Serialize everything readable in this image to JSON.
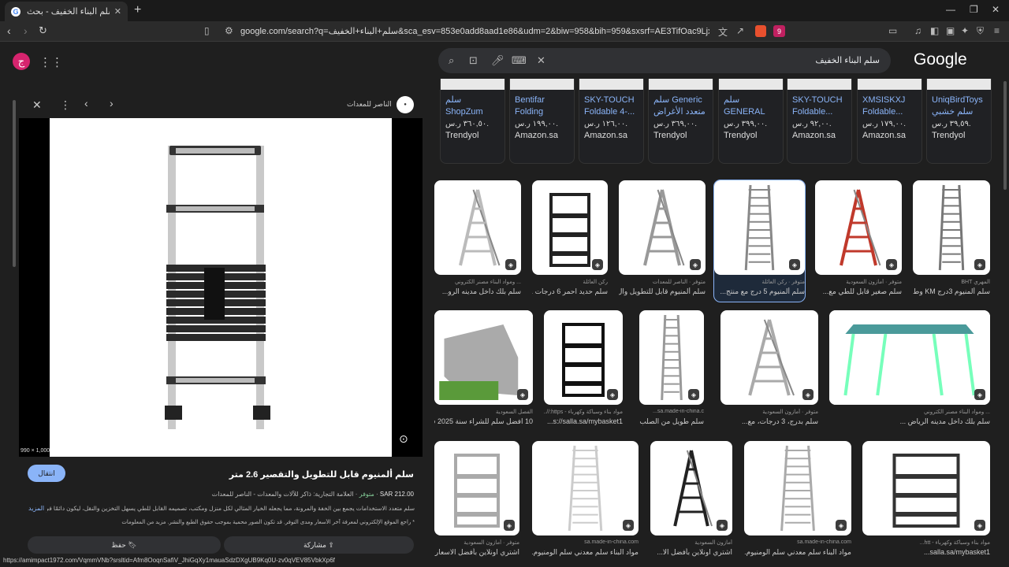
{
  "browser": {
    "tab_title": "سلم البناء الخفيف - بحث Google",
    "url": "google.com/search?q=سلم+البناء+الخفيف&sca_esv=853e0add8aad1e86&udm=2&biw=958&bih=959&sxsrf=AE3TifOac9Ljxx6mElPceLPNe4Me...",
    "status_url": "https://amimpact1972.com/VqmmVNb?srsltid=Afm8OoqnSafiV_JhiGqXy1mauaSdzDXgUB9Kq0U-zv0qVEV85VbkXp6f",
    "bat_count": "9"
  },
  "google": {
    "logo": "Google",
    "query": "سلم البناء الخفيف",
    "avatar_letter": "ج"
  },
  "panel": {
    "source_name": "الناصر للمعدات",
    "dims": "990 × 1,000",
    "title": "سلم ألمنيوم قابل للتطويل والتقصير 2.6 متر",
    "visit": "انتقال",
    "price": "SAR 212.00",
    "stock": "متوفر",
    "meta_rest": "العلامة التجارية: ذاكر للآلات والمعدات - الناصر للمعدات",
    "description": "سلم متعدد الاستخدامات يجمع بين الخفة والمرونة، مما يجعله الخيار المثالي لكل منزل ومكتب، تصميمه القابل للطي يسهل التخزين والنقل، ليكون دائمًا في",
    "more": "المزيد",
    "notice": "* راجع الموقع الإلكتروني لمعرفة آخر الأسعار ومدى التوفر. قد تكون الصور محمية بموجب حقوق الطبع والنشر. مزيد من المعلومات",
    "share": "مشاركة",
    "save": "حفظ"
  },
  "shopping": [
    {
      "name": "UniqBirdToys سلم خشبي كبير",
      "price": "٣٩,٥٩ ر.س.",
      "store": "Trendyol"
    },
    {
      "name": "XMSISKXJ Foldable...",
      "price": "١٧٩,٠٠ ر.س.",
      "store": "Amazon.sa"
    },
    {
      "name": "SKY-TOUCH Foldable...",
      "price": "٩٢,٠٠ ر.س.",
      "store": "Amazon.sa"
    },
    {
      "name": "سلم GENERAL تلسكوبي من...",
      "price": "٣٩٩,٠٠ ر.س.",
      "store": "Trendyol"
    },
    {
      "name": "سلم Generic متعدد الأغراض ق...",
      "price": "٣٦٩,٠٠ ر.س.",
      "store": "Trendyol"
    },
    {
      "name": "SKY-TOUCH Foldable 4-...",
      "price": "١٢٦,٠٠ ر.س.",
      "store": "Amazon.sa"
    },
    {
      "name": "Bentifar Folding Step...",
      "price": "١٩٩,٠٠ ر.س.",
      "store": "Amazon.sa"
    },
    {
      "name": "سلم ShopZum تلسكوبي من...",
      "price": "٣٦٠,٥٠ ر.س.",
      "store": "Trendyol"
    }
  ],
  "row1": [
    {
      "source": "المهري BHT",
      "title": "سلم ألمنيوم 3درج KM وط...",
      "avail": ""
    },
    {
      "source": "أمازون السعودية",
      "title": "سلم صغير قابل للطي مع...",
      "avail": "متوفر"
    },
    {
      "source": "ركن العائلة",
      "title": "سلم ألمنيوم 5 درج مع منتج...",
      "avail": "متوفر"
    },
    {
      "source": "الناصر للمعدات",
      "title": "سلم ألمنيوم قابل للتطويل وال...",
      "avail": "متوفر"
    },
    {
      "source": "ركن العائلة",
      "title": "سلم حديد احمر 6 درجات ...",
      "avail": ""
    },
    {
      "source": "... ومواد البناء مصنر الكتروني",
      "title": "سلم بلك داخل مدينه الرو...",
      "avail": ""
    }
  ],
  "row2": [
    {
      "source": "... ومواد البناء مصنر الكتروني",
      "title": "سلم بلك داخل مدينه الرياض ...",
      "avail": ""
    },
    {
      "source": "أمازون السعودية",
      "title": "سلم بدرج، 3 درجات، مع...",
      "avail": "متوفر"
    },
    {
      "source": "sa.made-in-china.c...",
      "title": "سلم طويل من الصلب و...",
      "avail": ""
    },
    {
      "source": "مواد بناء وسباكة وكهرباء - https://...",
      "title": "s://salla.sa/mybasket1...",
      "avail": ""
    },
    {
      "source": "الفصل السعودية",
      "title": "10 افضل سلم للشراء سنة 2025 في السعودية ...",
      "avail": ""
    }
  ],
  "row3": [
    {
      "source": "مواد بناء وسباكة وكهرباء - htt...",
      "title": "salla.sa/mybasket1...",
      "avail": ""
    },
    {
      "source": "sa.made-in-china.com",
      "title": "مواد البناء سلم معدني سلم الومنيوم...",
      "avail": ""
    },
    {
      "source": "أمازون السعودية",
      "title": "اشتري اونلاين بأفضل الا...",
      "avail": ""
    },
    {
      "source": "sa.made-in-china.com",
      "title": "مواد البناء سلم معدني سلم الومنيوم...",
      "avail": ""
    },
    {
      "source": "أمازون السعودية",
      "title": "اشتري اونلاين بأفضل الاسعار بالسعودية - ...",
      "avail": "متوفر"
    }
  ]
}
